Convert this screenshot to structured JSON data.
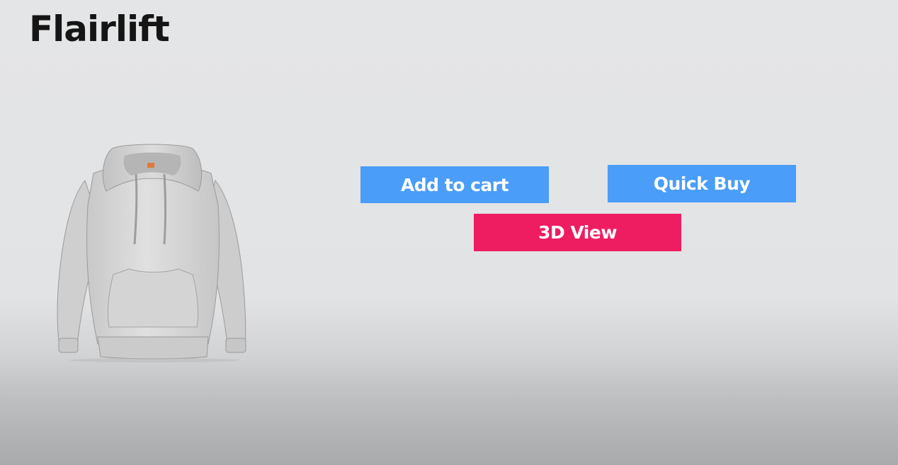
{
  "brand": {
    "name": "Flairlift"
  },
  "product": {
    "image": "grey-hoodie"
  },
  "actions": {
    "add_to_cart": "Add to cart",
    "quick_buy": "Quick Buy",
    "view_3d": "3D View"
  },
  "colors": {
    "primary_button": "#4a9df8",
    "accent_button": "#ee1d62",
    "brand_text": "#151515",
    "background": "#e3e4e6"
  }
}
